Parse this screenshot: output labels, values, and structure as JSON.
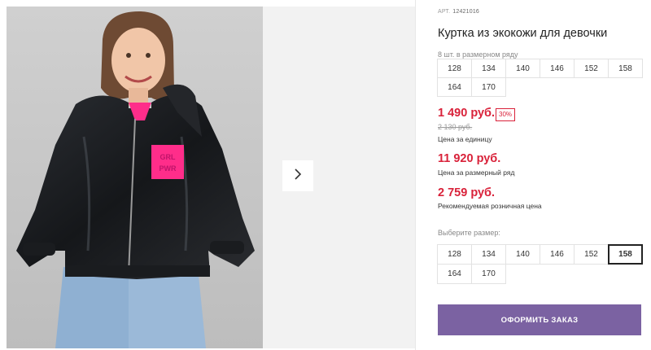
{
  "product": {
    "article_label": "АРТ.",
    "article_number": "12421016",
    "title": "Куртка из экокожи для девочки",
    "photo_patch_text": "GRL PWR"
  },
  "series": {
    "label": "8 шт. в размерном ряду",
    "sizes": [
      "128",
      "134",
      "140",
      "146",
      "152",
      "158",
      "164",
      "170"
    ]
  },
  "pricing": {
    "unit_price": "1 490 руб.",
    "discount_badge": "30%",
    "old_price": "2 130 руб.",
    "unit_price_note": "Цена за единицу",
    "series_price": "11 920 руб.",
    "series_price_note": "Цена за размерный ряд",
    "retail_price": "2 759 руб.",
    "retail_price_note": "Рекомендуемая розничная цена"
  },
  "size_picker": {
    "label": "Выберите размер:",
    "sizes": [
      "128",
      "134",
      "140",
      "146",
      "152",
      "158",
      "164",
      "170"
    ],
    "selected": "158"
  },
  "actions": {
    "order_label": "ОФОРМИТЬ ЗАКАЗ"
  },
  "colors": {
    "accent_price": "#d9223a",
    "button_bg": "#7b62a2",
    "jacket": "#1d1f23",
    "patch": "#ff2d8a"
  }
}
